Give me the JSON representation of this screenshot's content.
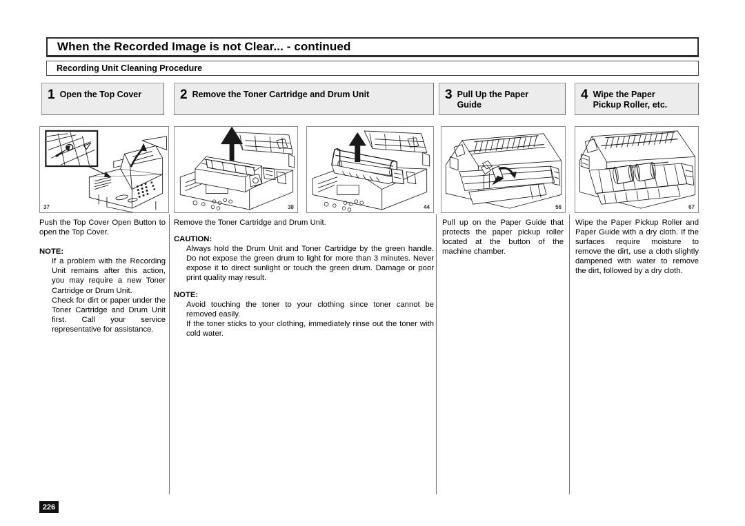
{
  "document": {
    "title": "When the Recorded Image is not Clear...  - continued",
    "section_title": "Recording Unit Cleaning Procedure",
    "page_number": "226"
  },
  "steps": [
    {
      "number": "1",
      "label": "Open the Top Cover",
      "figure_number": "37",
      "figure_alt": "fax-machine-top-cover-open-button",
      "body_lead": "Push the Top Cover Open Button to open the Top Cover.",
      "note_heading": "NOTE:",
      "note_paragraphs": [
        "If a problem with the Recording Unit remains after this action, you may require a new Toner Cartridge or Drum Unit.",
        "Check for dirt or paper under the Toner Cartridge and Drum Unit first. Call your service representative for assistance."
      ]
    },
    {
      "number": "2",
      "label": "Remove the Toner Cartridge and Drum Unit",
      "figure_number": "38",
      "figure_number_2": "44",
      "figure_alt": "toner-cartridge-lift-out",
      "figure_alt_2": "drum-unit-lift-out",
      "body_lead": "Remove the Toner Cartridge and Drum Unit.",
      "caution_heading": "CAUTION:",
      "caution_paragraphs": [
        "Always hold the Drum Unit and Toner Cartridge by the green handle. Do not expose the green drum to light for more than 3 minutes. Never expose it to direct sunlight or touch the green drum. Damage or poor print quality may result."
      ],
      "note_heading": "NOTE:",
      "note_paragraphs": [
        "Avoid touching the toner to your clothing since toner cannot be removed easily.",
        "If the toner sticks to your clothing, immediately rinse out the toner with cold water."
      ]
    },
    {
      "number": "3",
      "label": "Pull Up the Paper\nGuide",
      "figure_number": "56",
      "figure_alt": "paper-guide-pull-up",
      "body_lead": "Pull up on the Paper Guide that protects the paper pickup roller located at the button of the machine chamber."
    },
    {
      "number": "4",
      "label": "Wipe the Paper\nPickup Roller, etc.",
      "figure_number": "67",
      "figure_alt": "paper-pickup-roller-wipe",
      "body_lead": "Wipe the Paper Pickup Roller and Paper Guide with a dry cloth. If the surfaces require moisture to remove the dirt, use a cloth slightly dampened with water to remove the dirt, followed by a dry cloth."
    }
  ],
  "colors": {
    "text": "#000000",
    "step_box_bg": "#ececec",
    "step_box_border": "#9a9a9a",
    "rule": "#6f6f6f",
    "page_badge_bg": "#111111",
    "page_badge_text": "#ffffff"
  }
}
